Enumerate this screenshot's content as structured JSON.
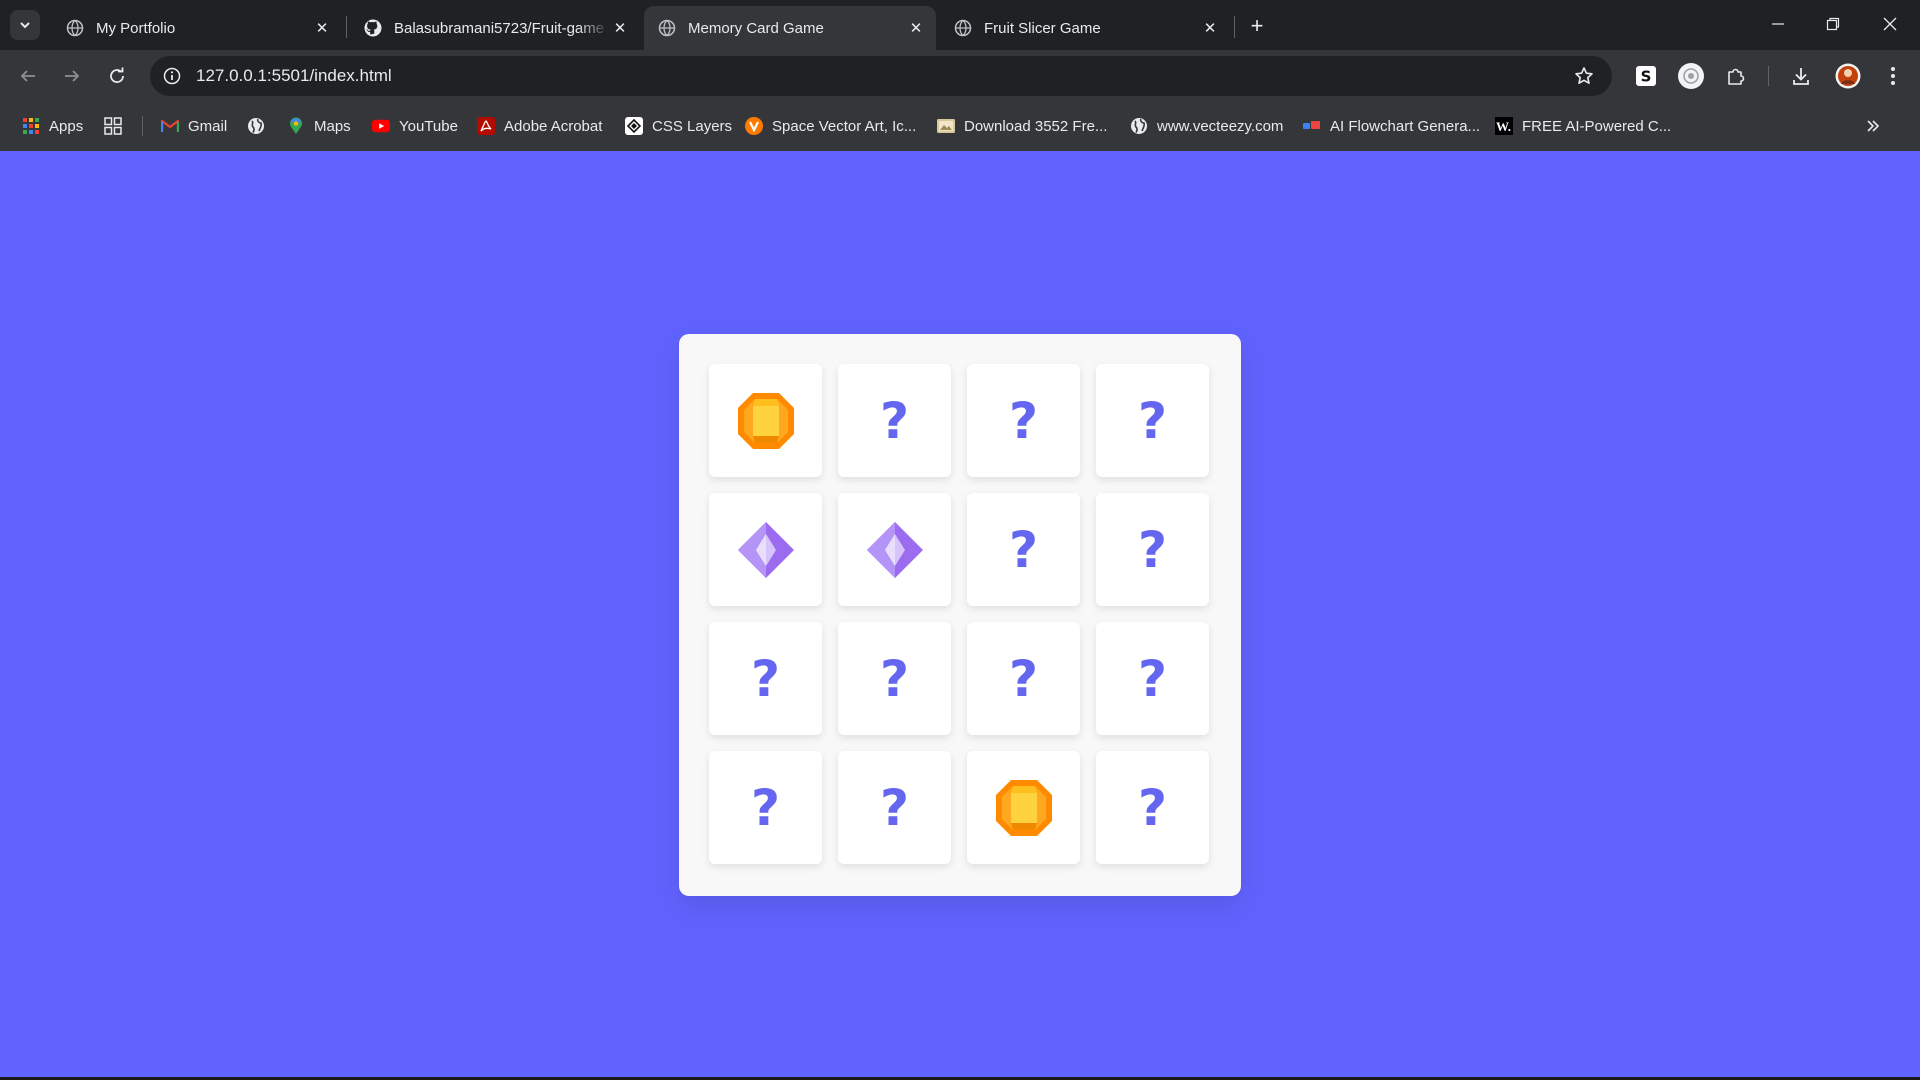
{
  "tabs": [
    {
      "title": "My Portfolio",
      "icon": "globe-icon",
      "active": false
    },
    {
      "title": "Balasubramani5723/Fruit-game",
      "icon": "github-icon",
      "active": false
    },
    {
      "title": "Memory Card Game",
      "icon": "globe-icon",
      "active": true
    },
    {
      "title": "Fruit Slicer Game",
      "icon": "globe-icon",
      "active": false
    }
  ],
  "toolbar": {
    "url": "127.0.0.1:5501/index.html"
  },
  "bookmarks": [
    {
      "label": "Apps",
      "icon": "apps-grid-icon"
    },
    {
      "label": "",
      "icon": "tab-groups-icon"
    },
    {
      "label": "Gmail",
      "icon": "gmail-icon"
    },
    {
      "label": "",
      "icon": "globe-icon"
    },
    {
      "label": "Maps",
      "icon": "maps-pin-icon"
    },
    {
      "label": "YouTube",
      "icon": "youtube-icon"
    },
    {
      "label": "Adobe Acrobat",
      "icon": "acrobat-icon"
    },
    {
      "label": "CSS Layers",
      "icon": "css-layers-icon"
    },
    {
      "label": "Space Vector Art, Ic...",
      "icon": "vecteezy-icon"
    },
    {
      "label": "Download 3552 Fre...",
      "icon": "image-icon"
    },
    {
      "label": "www.vecteezy.com",
      "icon": "globe-icon"
    },
    {
      "label": "AI Flowchart Genera...",
      "icon": "flowchart-icon"
    },
    {
      "label": "FREE AI-Powered C...",
      "icon": "w-icon"
    }
  ],
  "game": {
    "columns": 4,
    "rows": 4,
    "hidden_symbol": "?",
    "cards": [
      {
        "state": "revealed",
        "gem": "orange-gem"
      },
      {
        "state": "hidden"
      },
      {
        "state": "hidden"
      },
      {
        "state": "hidden"
      },
      {
        "state": "revealed",
        "gem": "purple-gem"
      },
      {
        "state": "revealed",
        "gem": "purple-gem"
      },
      {
        "state": "hidden"
      },
      {
        "state": "hidden"
      },
      {
        "state": "hidden"
      },
      {
        "state": "hidden"
      },
      {
        "state": "hidden"
      },
      {
        "state": "hidden"
      },
      {
        "state": "hidden"
      },
      {
        "state": "hidden"
      },
      {
        "state": "revealed",
        "gem": "orange-gem"
      },
      {
        "state": "hidden"
      }
    ]
  },
  "colors": {
    "page_background": "#6163ff",
    "board_background": "#f8f8f8",
    "question_mark": "#6566ef",
    "orange_gem": "#ff9f0a",
    "purple_gem": "#a57ef3"
  }
}
